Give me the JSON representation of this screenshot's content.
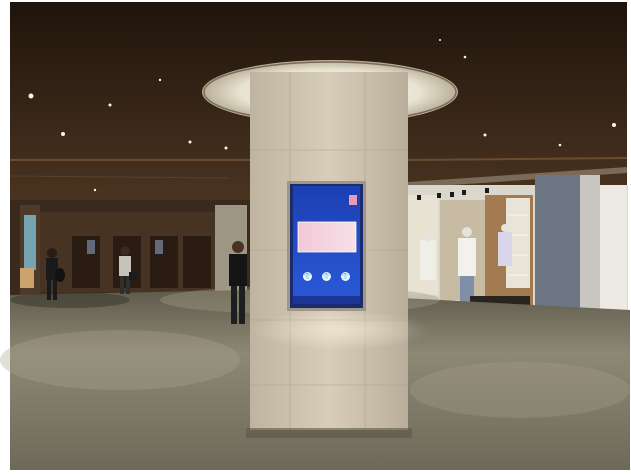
{
  "scene": {
    "kiosk": {
      "status_text": "",
      "heading": "",
      "icons": [
        "shirt-icon",
        "shirt-icon",
        "shirt-icon"
      ]
    },
    "store_sign": "",
    "colors": {
      "ceiling": "#2b1d12",
      "floor": "#8a8572",
      "pillar": "#d2c7b4",
      "kiosk_screen": "#2247c2",
      "recessed_glow": "#f2efe4"
    }
  }
}
